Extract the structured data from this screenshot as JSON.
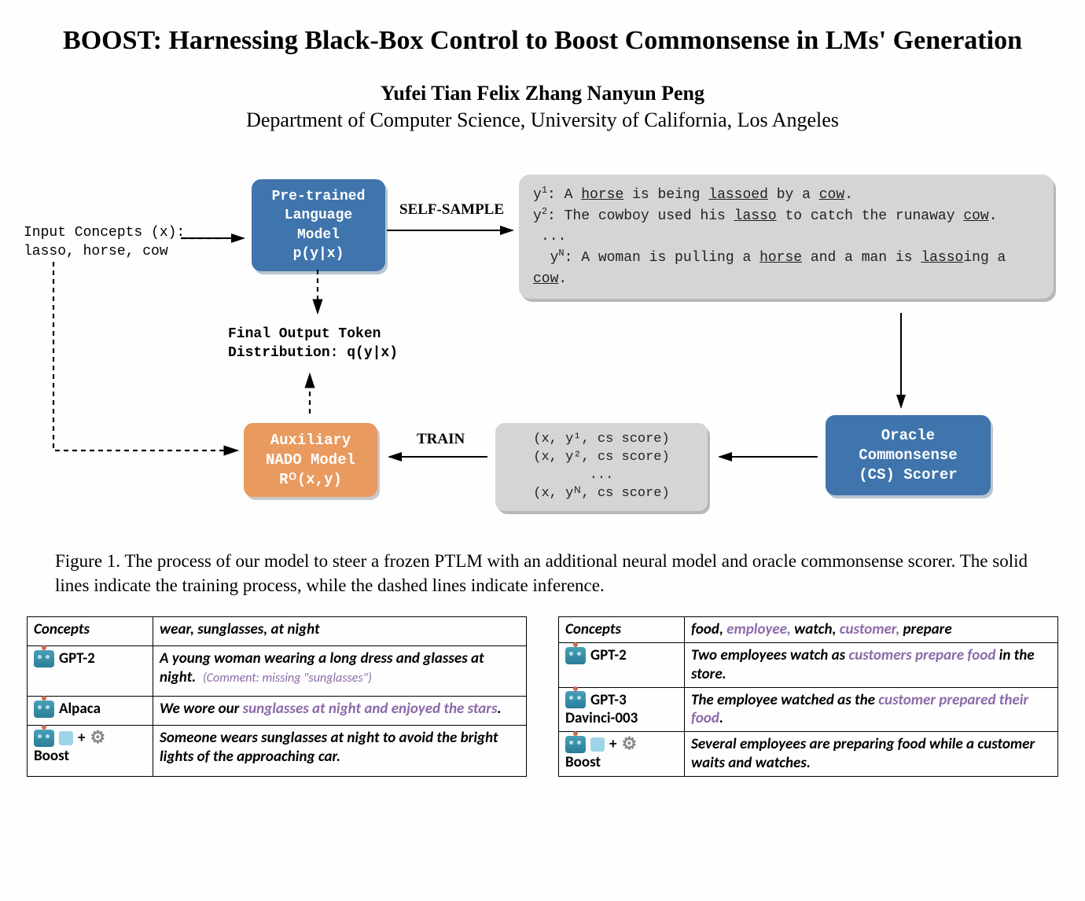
{
  "title_main": "BOOST: Harnessing Black-Box Control to Boost Commonsense in LMs' Generation",
  "authors": "Yufei Tian   Felix Zhang   Nanyun Peng",
  "affiliation": "Department of Computer Science, University of California, Los Angeles",
  "figure": {
    "input_label": "Input Concepts (x):",
    "input_concepts": "lasso, horse, cow",
    "ptlm_l1": "Pre-trained",
    "ptlm_l2": "Language",
    "ptlm_l3": "Model",
    "ptlm_l4": "p(y|x)",
    "selfsample": "SELF-SAMPLE",
    "samples": {
      "y1_pre": "y",
      "y1_sup": "1",
      "y1_a": ": A ",
      "y1_b": "horse",
      "y1_c": " is being ",
      "y1_d": "lassoed",
      "y1_e": " by a ",
      "y1_f": "cow",
      "y1_g": ".",
      "y2_pre": "y",
      "y2_sup": "2",
      "y2_a": ": The cowboy used his ",
      "y2_b": "lasso",
      "y2_c": " to catch the runaway ",
      "y2_d": "cow",
      "y2_e": ".",
      "dots": "...",
      "yn_pre": "y",
      "yn_sup": "N",
      "yn_a": ": A woman is pulling a ",
      "yn_b": "horse",
      "yn_c": " and a man is ",
      "yn_d": "lasso",
      "yn_e": "ing a ",
      "yn_f": "cow",
      "yn_g": "."
    },
    "final_output_l1": "Final Output Token",
    "final_output_l2": "Distribution: q(y|x)",
    "nado_l1": "Auxiliary",
    "nado_l2": "NADO Model",
    "nado_l3": "Rᴼ(x,y)",
    "train": "TRAIN",
    "tuples_l1": "(x, y¹, cs score)",
    "tuples_l2": "(x, y², cs score)",
    "tuples_dots": "...",
    "tuples_ln": "(x, yᴺ, cs score)",
    "oracle_l1": "Oracle",
    "oracle_l2": "Commonsense",
    "oracle_l3": "(CS) Scorer"
  },
  "caption": "Figure 1. The process of our model to steer a frozen PTLM with an additional neural model and oracle commonsense scorer. The solid lines indicate the training process, while the dashed lines indicate inference.",
  "tableL": {
    "concepts_label": "Concepts",
    "concepts": "wear, sunglasses, at night",
    "gpt2_label": "GPT-2",
    "gpt2_text": "A young woman wearing a long dress and glasses at night.",
    "gpt2_comment": "(Comment: missing \"sunglasses\")",
    "alpaca_label": "Alpaca",
    "alpaca_a": "We wore our ",
    "alpaca_b": "sunglasses at night and enjoyed the stars",
    "alpaca_c": ".",
    "boost_label": "Boost",
    "boost_text": "Someone wears sunglasses at night to avoid the bright lights of the approaching car.",
    "plus": "+"
  },
  "tableR": {
    "concepts_label": "Concepts",
    "c1": "food, ",
    "c2": "employee,",
    "c3": " watch, ",
    "c4": "customer,",
    "c5": " prepare",
    "gpt2_label": "GPT-2",
    "gpt2_a": "Two employees watch as ",
    "gpt2_b": "customers prepare food",
    "gpt2_c": " in the store.",
    "gpt3_label_l1": "GPT-3",
    "gpt3_label_l2": "Davinci-003",
    "gpt3_a": "The employee watched as the ",
    "gpt3_b": "customer prepared their food",
    "gpt3_c": ".",
    "boost_label": "Boost",
    "boost_text": "Several employees are preparing food while a customer waits and watches.",
    "plus": "+"
  }
}
